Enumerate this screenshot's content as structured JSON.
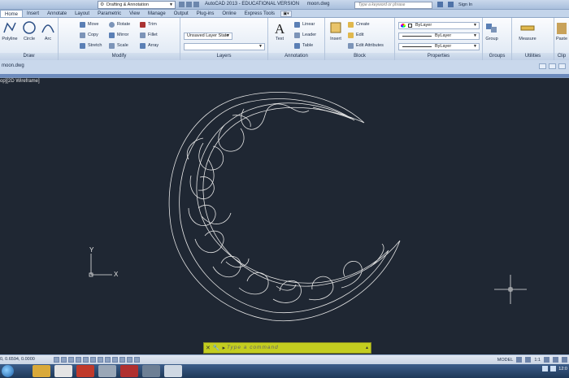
{
  "titlebar": {
    "workspace": "Drafting & Annotation",
    "title": "AutoCAD 2013 - EDUCATIONAL VERSION",
    "filename": "moon.dwg",
    "search_placeholder": "Type a keyword or phrase",
    "signin": "Sign In"
  },
  "tabs": [
    "Home",
    "Insert",
    "Annotate",
    "Layout",
    "Parametric",
    "View",
    "Manage",
    "Output",
    "Plug-ins",
    "Online",
    "Express Tools"
  ],
  "ribbon": {
    "draw": {
      "label": "Draw",
      "polyline": "Polyline",
      "circle": "Circle",
      "arc": "Arc"
    },
    "modify": {
      "label": "Modify",
      "move": "Move",
      "rotate": "Rotate",
      "trim": "Trim",
      "copy": "Copy",
      "mirror": "Mirror",
      "fillet": "Fillet",
      "stretch": "Stretch",
      "scale": "Scale",
      "array": "Array"
    },
    "layers": {
      "label": "Layers",
      "layer_state": "Unsaved Layer State"
    },
    "annotation": {
      "label": "Annotation",
      "text": "Text",
      "linear": "Linear",
      "leader": "Leader",
      "table": "Table"
    },
    "block": {
      "label": "Block",
      "insert": "Insert",
      "create": "Create",
      "edit": "Edit",
      "edit_attributes": "Edit Attributes"
    },
    "properties": {
      "label": "Properties",
      "color": "ByLayer",
      "linetype": "ByLayer",
      "lineweight": "ByLayer"
    },
    "groups": {
      "label": "Groups",
      "group": "Group"
    },
    "utilities": {
      "label": "Utilities",
      "measure": "Measure"
    },
    "clipboard": {
      "label": "Clip",
      "paste": "Paste"
    }
  },
  "document": {
    "tab_name": "moon.dwg",
    "viewport_label": "op][2D Wireframe]",
    "ucs_x": "X",
    "ucs_y": "Y"
  },
  "commandline": {
    "prompt": "Type a command"
  },
  "statusbar": {
    "coords": "0, 0.6594, 0.0000",
    "model": "MODEL",
    "scale": "1:1"
  },
  "taskbar": {
    "clock": "12:0"
  },
  "colors": {
    "viewport_bg": "#1f2733",
    "command_bg": "#c3cd1f",
    "drawing_stroke": "#e6e6e6"
  }
}
